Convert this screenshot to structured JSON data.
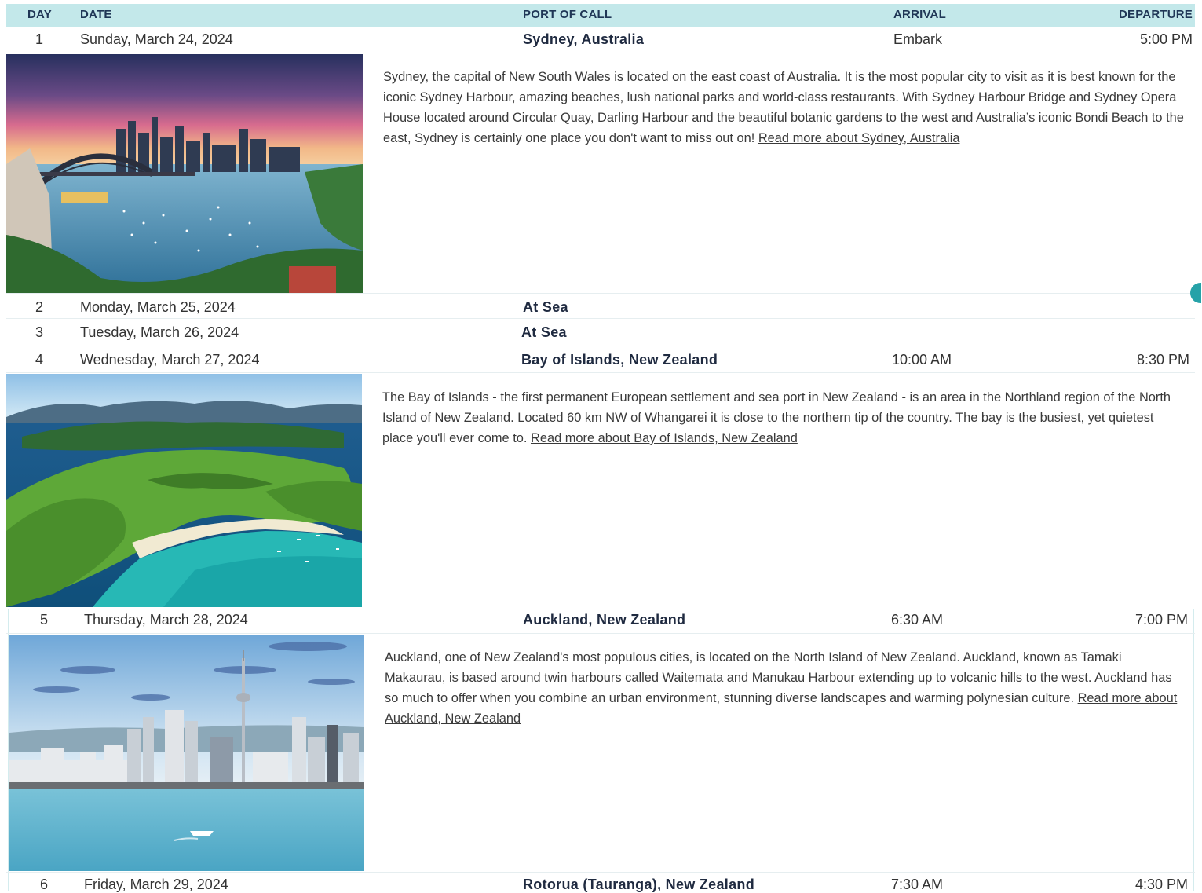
{
  "header": {
    "day": "DAY",
    "date": "DATE",
    "port": "PORT OF CALL",
    "arrival": "ARRIVAL",
    "departure": "DEPARTURE"
  },
  "rows": [
    {
      "day": "1",
      "date": "Sunday, March 24, 2024",
      "port": "Sydney, Australia",
      "arrival": "Embark",
      "departure": "5:00 PM",
      "description": "Sydney, the capital of New South Wales is located on the east coast of Australia. It is the most popular city to visit as it is best known for the iconic Sydney Harbour, amazing beaches, lush national parks and world-class restaurants. With Sydney Harbour Bridge and Sydney Opera House located around Circular Quay, Darling Harbour and the beautiful botanic gardens to the west and Australia’s iconic Bondi Beach to the east, Sydney is certainly one place you don't want to miss out on!",
      "link": "Read more about Sydney, Australia"
    },
    {
      "day": "2",
      "date": "Monday, March 25, 2024",
      "port": "At Sea",
      "arrival": "",
      "departure": ""
    },
    {
      "day": "3",
      "date": "Tuesday, March 26, 2024",
      "port": "At Sea",
      "arrival": "",
      "departure": ""
    },
    {
      "day": "4",
      "date": "Wednesday, March 27, 2024",
      "port": "Bay of Islands, New Zealand",
      "arrival": "10:00 AM",
      "departure": "8:30 PM",
      "description": "The Bay of Islands - the first permanent European settlement and sea port in New Zealand - is an area in the Northland region of the North Island of New Zealand. Located 60 km NW of Whangarei it is close to the northern tip of the country. The bay is the busiest, yet quietest place you'll ever come to.",
      "link": "Read more about Bay of Islands, New Zealand"
    },
    {
      "day": "5",
      "date": "Thursday, March 28, 2024",
      "port": "Auckland, New Zealand",
      "arrival": "6:30 AM",
      "departure": "7:00 PM",
      "description": "Auckland, one of New Zealand's most populous cities, is located on the North Island of New Zealand. Auckland, known as Tamaki Makaurau, is based around twin harbours called Waitemata and Manukau Harbour extending up to volcanic hills to the west. Auckland has so much to offer when you combine an urban environment, stunning diverse landscapes and warming polynesian culture.",
      "link": "Read more about Auckland, New Zealand"
    },
    {
      "day": "6",
      "date": "Friday, March 29, 2024",
      "port": "Rotorua (Tauranga), New Zealand",
      "arrival": "7:30 AM",
      "departure": "4:30 PM"
    }
  ]
}
